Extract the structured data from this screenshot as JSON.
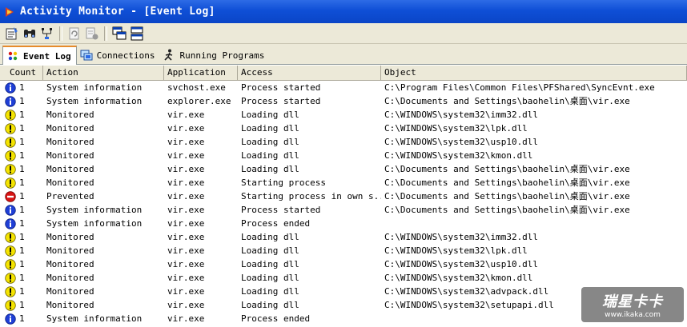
{
  "window": {
    "title": "Activity Monitor - [Event Log]"
  },
  "toolbar": {
    "buttons": [
      {
        "icon": "properties-icon"
      },
      {
        "icon": "find-icon"
      },
      {
        "icon": "filter-icon"
      },
      {
        "icon": "refresh-icon"
      },
      {
        "icon": "clear-icon"
      },
      {
        "icon": "cascade-icon"
      },
      {
        "icon": "tile-icon"
      }
    ]
  },
  "tabs": [
    {
      "label": "Event Log",
      "icon": "event-log-icon",
      "active": true
    },
    {
      "label": "Connections",
      "icon": "connections-icon",
      "active": false
    },
    {
      "label": "Running Programs",
      "icon": "running-programs-icon",
      "active": false
    }
  ],
  "table": {
    "columns": [
      "Count",
      "Action",
      "Application",
      "Access",
      "Object"
    ],
    "rows": [
      {
        "type": "info",
        "count": "1",
        "action": "System information",
        "app": "svchost.exe",
        "access": "Process started",
        "object": "C:\\Program Files\\Common Files\\PFShared\\SyncEvnt.exe"
      },
      {
        "type": "info",
        "count": "1",
        "action": "System information",
        "app": "explorer.exe",
        "access": "Process started",
        "object": "C:\\Documents and Settings\\baohelin\\桌面\\vir.exe"
      },
      {
        "type": "warn",
        "count": "1",
        "action": "Monitored",
        "app": "vir.exe",
        "access": "Loading dll",
        "object": "C:\\WINDOWS\\system32\\imm32.dll"
      },
      {
        "type": "warn",
        "count": "1",
        "action": "Monitored",
        "app": "vir.exe",
        "access": "Loading dll",
        "object": "C:\\WINDOWS\\system32\\lpk.dll"
      },
      {
        "type": "warn",
        "count": "1",
        "action": "Monitored",
        "app": "vir.exe",
        "access": "Loading dll",
        "object": "C:\\WINDOWS\\system32\\usp10.dll"
      },
      {
        "type": "warn",
        "count": "1",
        "action": "Monitored",
        "app": "vir.exe",
        "access": "Loading dll",
        "object": "C:\\WINDOWS\\system32\\kmon.dll"
      },
      {
        "type": "warn",
        "count": "1",
        "action": "Monitored",
        "app": "vir.exe",
        "access": "Loading dll",
        "object": "C:\\Documents and Settings\\baohelin\\桌面\\vir.exe"
      },
      {
        "type": "warn",
        "count": "1",
        "action": "Monitored",
        "app": "vir.exe",
        "access": "Starting process",
        "object": "C:\\Documents and Settings\\baohelin\\桌面\\vir.exe"
      },
      {
        "type": "stop",
        "count": "1",
        "action": "Prevented",
        "app": "vir.exe",
        "access": "Starting process in own s...",
        "object": "C:\\Documents and Settings\\baohelin\\桌面\\vir.exe"
      },
      {
        "type": "info",
        "count": "1",
        "action": "System information",
        "app": "vir.exe",
        "access": "Process started",
        "object": "C:\\Documents and Settings\\baohelin\\桌面\\vir.exe"
      },
      {
        "type": "info",
        "count": "1",
        "action": "System information",
        "app": "vir.exe",
        "access": "Process ended",
        "object": ""
      },
      {
        "type": "warn",
        "count": "1",
        "action": "Monitored",
        "app": "vir.exe",
        "access": "Loading dll",
        "object": "C:\\WINDOWS\\system32\\imm32.dll"
      },
      {
        "type": "warn",
        "count": "1",
        "action": "Monitored",
        "app": "vir.exe",
        "access": "Loading dll",
        "object": "C:\\WINDOWS\\system32\\lpk.dll"
      },
      {
        "type": "warn",
        "count": "1",
        "action": "Monitored",
        "app": "vir.exe",
        "access": "Loading dll",
        "object": "C:\\WINDOWS\\system32\\usp10.dll"
      },
      {
        "type": "warn",
        "count": "1",
        "action": "Monitored",
        "app": "vir.exe",
        "access": "Loading dll",
        "object": "C:\\WINDOWS\\system32\\kmon.dll"
      },
      {
        "type": "warn",
        "count": "1",
        "action": "Monitored",
        "app": "vir.exe",
        "access": "Loading dll",
        "object": "C:\\WINDOWS\\system32\\advpack.dll"
      },
      {
        "type": "warn",
        "count": "1",
        "action": "Monitored",
        "app": "vir.exe",
        "access": "Loading dll",
        "object": "C:\\WINDOWS\\system32\\setupapi.dll"
      },
      {
        "type": "info",
        "count": "1",
        "action": "System information",
        "app": "vir.exe",
        "access": "Process ended",
        "object": ""
      }
    ]
  },
  "watermark": {
    "line1": "瑞星卡卡",
    "line2": "www.ikaka.com"
  },
  "colors": {
    "titlebar": "#0a45c7",
    "info": "#1f3fd6",
    "warn": "#f5e400",
    "stop": "#d81414"
  }
}
